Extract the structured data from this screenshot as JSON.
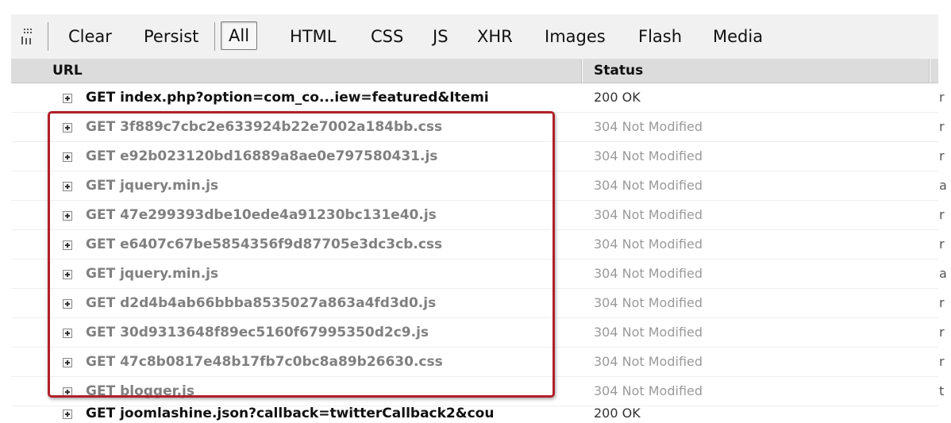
{
  "toolbar": {
    "grip_icon": "panel-grip-icon",
    "buttons": [
      "Clear",
      "Persist",
      "All",
      "HTML",
      "CSS",
      "JS",
      "XHR",
      "Images",
      "Flash",
      "Media"
    ],
    "active": "All"
  },
  "columns": {
    "url": "URL",
    "status": "Status"
  },
  "requests": [
    {
      "url": "GET index.php?option=com_co...iew=featured&Itemi",
      "status": "200 OK",
      "extra": "r",
      "cached": false
    },
    {
      "url": "GET 3f889c7cbc2e633924b22e7002a184bb.css",
      "status": "304 Not Modified",
      "extra": "r",
      "cached": true
    },
    {
      "url": "GET e92b023120bd16889a8ae0e797580431.js",
      "status": "304 Not Modified",
      "extra": "r",
      "cached": true
    },
    {
      "url": "GET jquery.min.js",
      "status": "304 Not Modified",
      "extra": "a",
      "cached": true
    },
    {
      "url": "GET 47e299393dbe10ede4a91230bc131e40.js",
      "status": "304 Not Modified",
      "extra": "r",
      "cached": true
    },
    {
      "url": "GET e6407c67be5854356f9d87705e3dc3cb.css",
      "status": "304 Not Modified",
      "extra": "r",
      "cached": true
    },
    {
      "url": "GET jquery.min.js",
      "status": "304 Not Modified",
      "extra": "a",
      "cached": true
    },
    {
      "url": "GET d2d4b4ab66bbba8535027a863a4fd3d0.js",
      "status": "304 Not Modified",
      "extra": "r",
      "cached": true
    },
    {
      "url": "GET 30d9313648f89ec5160f67995350d2c9.js",
      "status": "304 Not Modified",
      "extra": "r",
      "cached": true
    },
    {
      "url": "GET 47c8b0817e48b17fb7c0bc8a89b26630.css",
      "status": "304 Not Modified",
      "extra": "r",
      "cached": true
    },
    {
      "url": "GET blogger.js",
      "status": "304 Not Modified",
      "extra": "t",
      "cached": true
    },
    {
      "url": "GET joomlashine.json?callback=twitterCallback2&cou",
      "status": "200 OK",
      "extra": "a",
      "cached": false
    }
  ],
  "colors": {
    "highlight_border": "#b0202a",
    "cached_text": "#808080",
    "toolbar_bg": "#f1f1f1",
    "header_bg": "#dcdcdc"
  }
}
